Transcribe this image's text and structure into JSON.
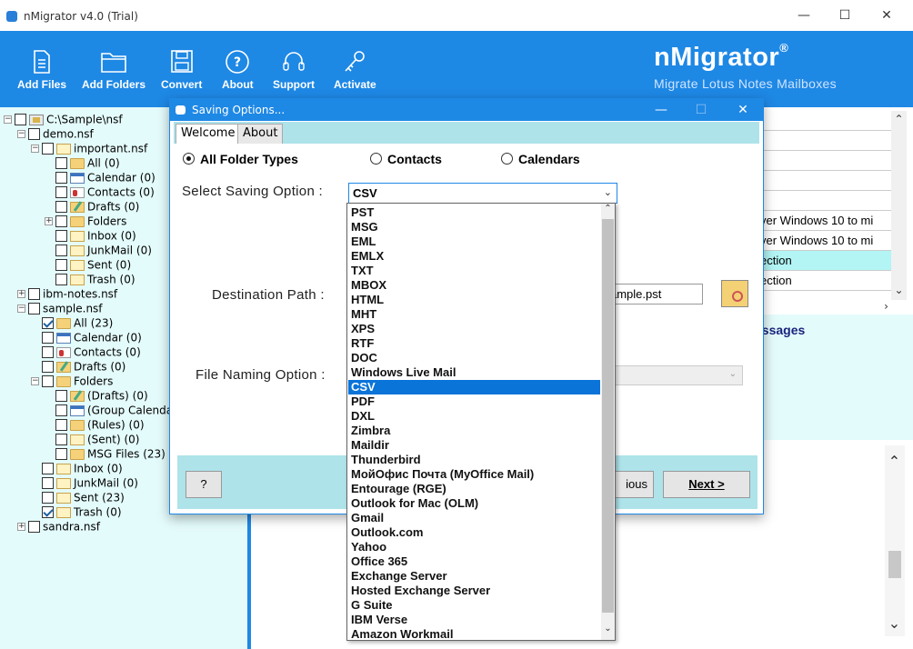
{
  "window": {
    "title": "nMigrator v4.0 (Trial)",
    "minimize": "—",
    "maximize": "☐",
    "close": "✕"
  },
  "toolbar": {
    "add_files": "Add Files",
    "add_folders": "Add Folders",
    "convert": "Convert",
    "about": "About",
    "support": "Support",
    "activate": "Activate"
  },
  "brand": {
    "name": "nMigrator",
    "reg": "®",
    "tagline": "Migrate Lotus Notes Mailboxes",
    "accent": "#1e88e5"
  },
  "tree": [
    {
      "label": "C:\\Sample\\nsf",
      "indent": 0,
      "expander": "−",
      "checked": false,
      "icon": "nsf"
    },
    {
      "label": "demo.nsf",
      "indent": 1,
      "expander": "−",
      "checked": false,
      "icon": "none"
    },
    {
      "label": "important.nsf",
      "indent": 2,
      "expander": "−",
      "checked": false,
      "icon": "mail"
    },
    {
      "label": "All (0)",
      "indent": 3,
      "expander": "",
      "checked": false,
      "icon": "folder"
    },
    {
      "label": "Calendar (0)",
      "indent": 3,
      "expander": "",
      "checked": false,
      "icon": "cal"
    },
    {
      "label": "Contacts (0)",
      "indent": 3,
      "expander": "",
      "checked": false,
      "icon": "contact"
    },
    {
      "label": "Drafts (0)",
      "indent": 3,
      "expander": "",
      "checked": false,
      "icon": "draft"
    },
    {
      "label": "Folders",
      "indent": 3,
      "expander": "+",
      "checked": false,
      "icon": "folder"
    },
    {
      "label": "Inbox (0)",
      "indent": 3,
      "expander": "",
      "checked": false,
      "icon": "mail"
    },
    {
      "label": "JunkMail (0)",
      "indent": 3,
      "expander": "",
      "checked": false,
      "icon": "mail"
    },
    {
      "label": "Sent (0)",
      "indent": 3,
      "expander": "",
      "checked": false,
      "icon": "mail"
    },
    {
      "label": "Trash (0)",
      "indent": 3,
      "expander": "",
      "checked": false,
      "icon": "mail"
    },
    {
      "label": "ibm-notes.nsf",
      "indent": 1,
      "expander": "+",
      "checked": false,
      "icon": "none"
    },
    {
      "label": "sample.nsf",
      "indent": 1,
      "expander": "−",
      "checked": false,
      "icon": "none"
    },
    {
      "label": "All (23)",
      "indent": 2,
      "expander": "",
      "checked": true,
      "icon": "folder"
    },
    {
      "label": "Calendar (0)",
      "indent": 2,
      "expander": "",
      "checked": false,
      "icon": "cal"
    },
    {
      "label": "Contacts (0)",
      "indent": 2,
      "expander": "",
      "checked": false,
      "icon": "contact"
    },
    {
      "label": "Drafts (0)",
      "indent": 2,
      "expander": "",
      "checked": false,
      "icon": "draft"
    },
    {
      "label": "Folders",
      "indent": 2,
      "expander": "−",
      "checked": false,
      "icon": "folder"
    },
    {
      "label": "(Drafts) (0)",
      "indent": 3,
      "expander": "",
      "checked": false,
      "icon": "draft"
    },
    {
      "label": "(Group Calenda",
      "indent": 3,
      "expander": "",
      "checked": false,
      "icon": "cal"
    },
    {
      "label": "(Rules) (0)",
      "indent": 3,
      "expander": "",
      "checked": false,
      "icon": "folder"
    },
    {
      "label": "(Sent) (0)",
      "indent": 3,
      "expander": "",
      "checked": false,
      "icon": "mail"
    },
    {
      "label": "MSG Files (23)",
      "indent": 3,
      "expander": "",
      "checked": false,
      "icon": "folder"
    },
    {
      "label": "Inbox (0)",
      "indent": 2,
      "expander": "",
      "checked": false,
      "icon": "mail"
    },
    {
      "label": "JunkMail (0)",
      "indent": 2,
      "expander": "",
      "checked": false,
      "icon": "mail"
    },
    {
      "label": "Sent (23)",
      "indent": 2,
      "expander": "",
      "checked": false,
      "icon": "mail"
    },
    {
      "label": "Trash (0)",
      "indent": 2,
      "expander": "",
      "checked": true,
      "icon": "mail"
    },
    {
      "label": "sandra.nsf",
      "indent": 1,
      "expander": "+",
      "checked": false,
      "icon": "none"
    }
  ],
  "grid_rows": [
    {
      "text": "",
      "highlight": false
    },
    {
      "text": "",
      "highlight": false
    },
    {
      "text": "",
      "highlight": false
    },
    {
      "text": "",
      "highlight": false
    },
    {
      "text": "",
      "highlight": false
    },
    {
      "text": "ver Windows 10 to mi",
      "highlight": false
    },
    {
      "text": "ver Windows 10 to mi",
      "highlight": false
    },
    {
      "text": "ection",
      "highlight": true
    },
    {
      "text": "ection",
      "highlight": false
    }
  ],
  "preview": {
    "heading": "essages"
  },
  "dialog": {
    "title": "Saving Options...",
    "tabs": [
      "Welcome",
      "About"
    ],
    "radios": [
      {
        "label": "All Folder Types",
        "selected": true
      },
      {
        "label": "Contacts",
        "selected": false
      },
      {
        "label": "Calendars",
        "selected": false
      }
    ],
    "select_label": "Select Saving Option :",
    "select_value": "CSV",
    "dest_label": "Destination Path :",
    "dest_value": "ample.pst",
    "naming_label": "File Naming Option :",
    "help_button": "?",
    "previous_button": "ious",
    "next_button": "Next >"
  },
  "dropdown": {
    "highlighted": "CSV",
    "options": [
      "PST",
      "MSG",
      "EML",
      "EMLX",
      "TXT",
      "MBOX",
      "HTML",
      "MHT",
      "XPS",
      "RTF",
      "DOC",
      "Windows Live Mail",
      "CSV",
      "PDF",
      "DXL",
      "Zimbra",
      "Maildir",
      "Thunderbird",
      "МойОфис Почта (MyOffice Mail)",
      "Entourage (RGE)",
      "Outlook for Mac (OLM)",
      "Gmail",
      "Outlook.com",
      "Yahoo",
      "Office 365",
      "Exchange Server",
      "Hosted Exchange Server",
      "G Suite",
      "IBM Verse",
      "Amazon Workmail"
    ]
  }
}
